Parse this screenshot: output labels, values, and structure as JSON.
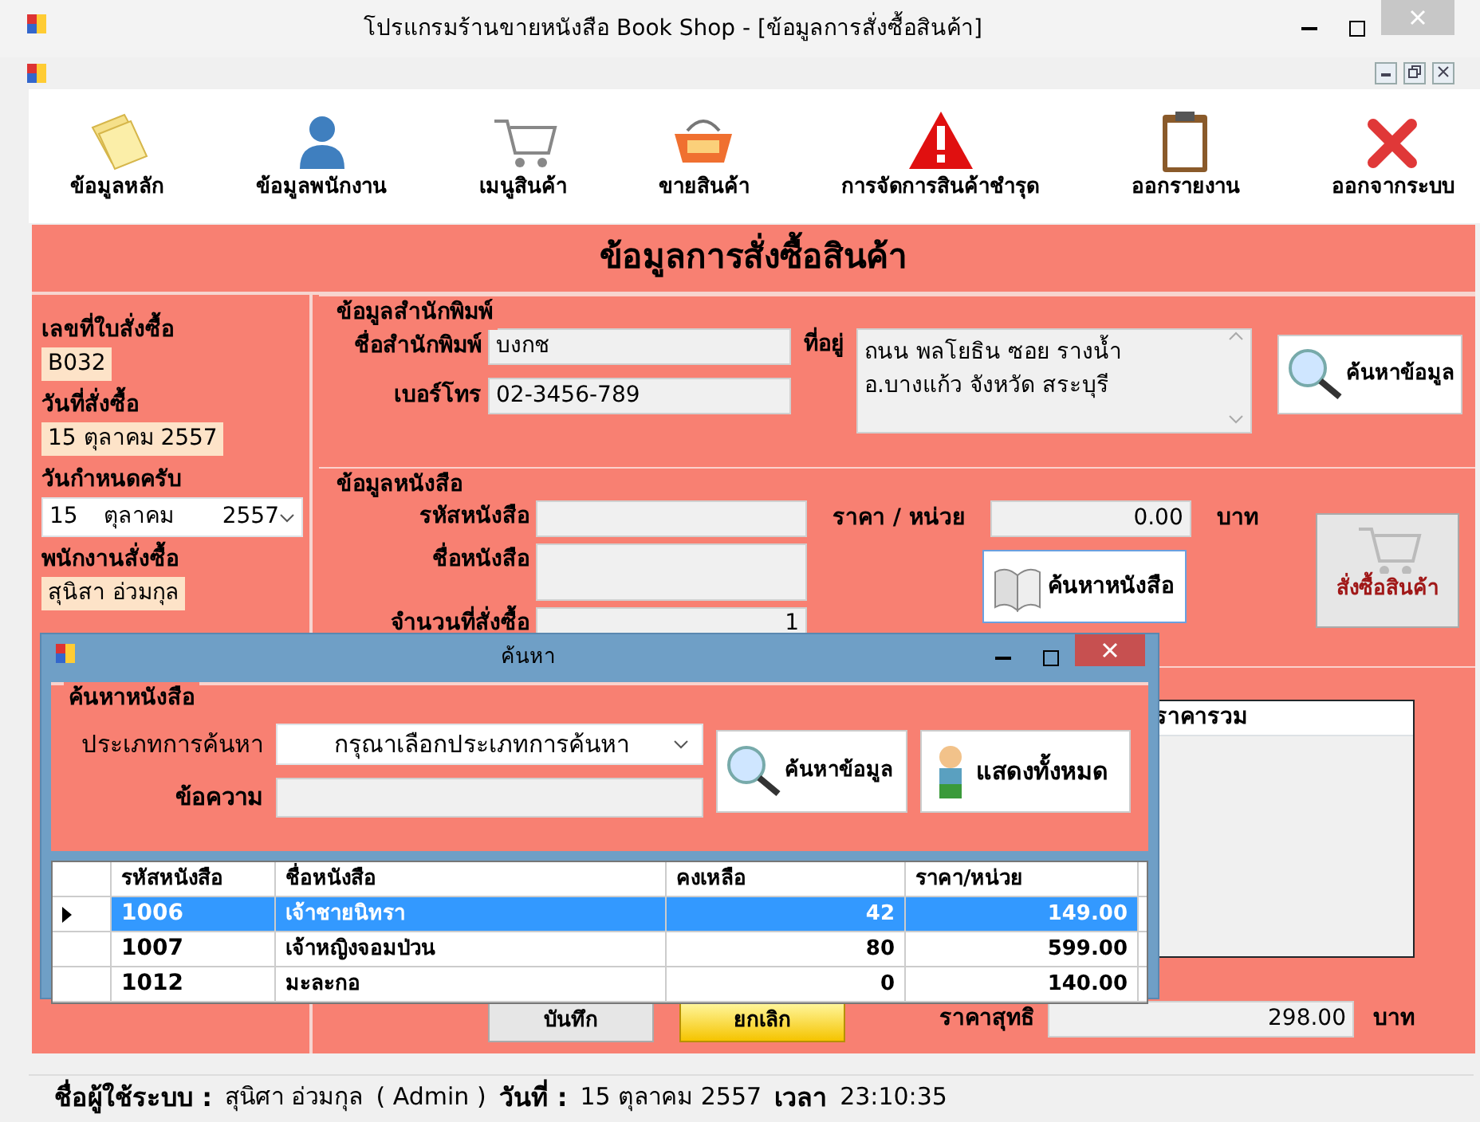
{
  "window": {
    "title": "โปรแกรมร้านขายหนังสือ Book Shop - [ข้อมูลการสั่งซื้อสินค้า]"
  },
  "toolbar": [
    {
      "label": "ข้อมูลหลัก",
      "kind": "notes"
    },
    {
      "label": "ข้อมูลพนักงาน",
      "kind": "person"
    },
    {
      "label": "เมนูสินค้า",
      "kind": "cart"
    },
    {
      "label": "ขายสินค้า",
      "kind": "basket"
    },
    {
      "label": "การจัดการสินค้าชำรุด",
      "kind": "warning"
    },
    {
      "label": "ออกรายงาน",
      "kind": "clipboard"
    },
    {
      "label": "ออกจากระบบ",
      "kind": "exit"
    }
  ],
  "form_title": "ข้อมูลการสั่งซื้อสินค้า",
  "order_panel": {
    "order_no_label": "เลขที่ใบสั่งซื้อ",
    "order_no": "B032",
    "order_date_label": "วันที่สั่งซื้อ",
    "order_date": "15 ตุลาคม 2557",
    "due_date_label": "วันกำหนดครับ",
    "due_day": "15",
    "due_month": "ตุลาคม",
    "due_year": "2557",
    "employee_label": "พนักงานสั่งซื้อ",
    "employee": "สุนิสา อ่วมกุล"
  },
  "publisher": {
    "group_title": "ข้อมูลสำนักพิมพ์",
    "name_label": "ชื่อสำนักพิมพ์",
    "name": "บงกช",
    "phone_label": "เบอร์โทร",
    "phone": "02-3456-789",
    "address_label": "ที่อยู่",
    "address_lines": [
      "ถนน พลโยธิน ซอย รางน้ำ",
      "อ.บางแก้ว จังหวัด สระบุรี"
    ],
    "search_button": "ค้นหาข้อมูล"
  },
  "book": {
    "group_title": "ข้อมูลหนังสือ",
    "code_label": "รหัสหนังสือ",
    "name_label": "ชื่อหนังสือ",
    "qty_label": "จำนวนที่สั่งซื้อ",
    "qty": "1",
    "price_label": "ราคา / หน่วย",
    "price": "0.00",
    "unit": "บาท",
    "search_button": "ค้นหาหนังสือ",
    "order_button": {
      "label": "สั่งซื้อสินค้า",
      "disabled": true
    }
  },
  "order_list": {
    "column_header": "ราคารวม",
    "total_label": "ราคาสุทธิ",
    "total": "298.00",
    "unit": "บาท"
  },
  "buttons": [
    {
      "label": "บันทึก",
      "kind": "save"
    },
    {
      "label": "ยกเลิก",
      "kind": "cancel"
    }
  ],
  "dialog": {
    "title": "ค้นหา",
    "group_title": "ค้นหาหนังสือ",
    "type_label": "ประเภทการค้นหา",
    "type_value": "กรุณาเลือกประเภทการค้นหา",
    "text_label": "ข้อความ",
    "search_button": "ค้นหาข้อมูล",
    "show_all_button": "แสดงทั้งหมด",
    "columns": [
      "รหัสหนังสือ",
      "ชื่อหนังสือ",
      "คงเหลือ",
      "ราคา/หน่วย"
    ],
    "rows": [
      {
        "cells": [
          "1006",
          "เจ้าชายนิทรา",
          "42",
          "149.00"
        ],
        "selected": true
      },
      {
        "cells": [
          "1007",
          "เจ้าหญิงจอมป่วน",
          "80",
          "599.00"
        ],
        "selected": false
      },
      {
        "cells": [
          "1012",
          "มะละกอ",
          "0",
          "140.00"
        ],
        "selected": false
      }
    ]
  },
  "status_bar": {
    "user_label": "ชื่อผู้ใช้ระบบ :",
    "user": "สุนิศา อ่วมกุล",
    "role": "( Admin )",
    "date_label": "วันที่ :",
    "date": "15 ตุลาคม 2557",
    "time_label": "เวลา",
    "time": "23:10:35"
  }
}
